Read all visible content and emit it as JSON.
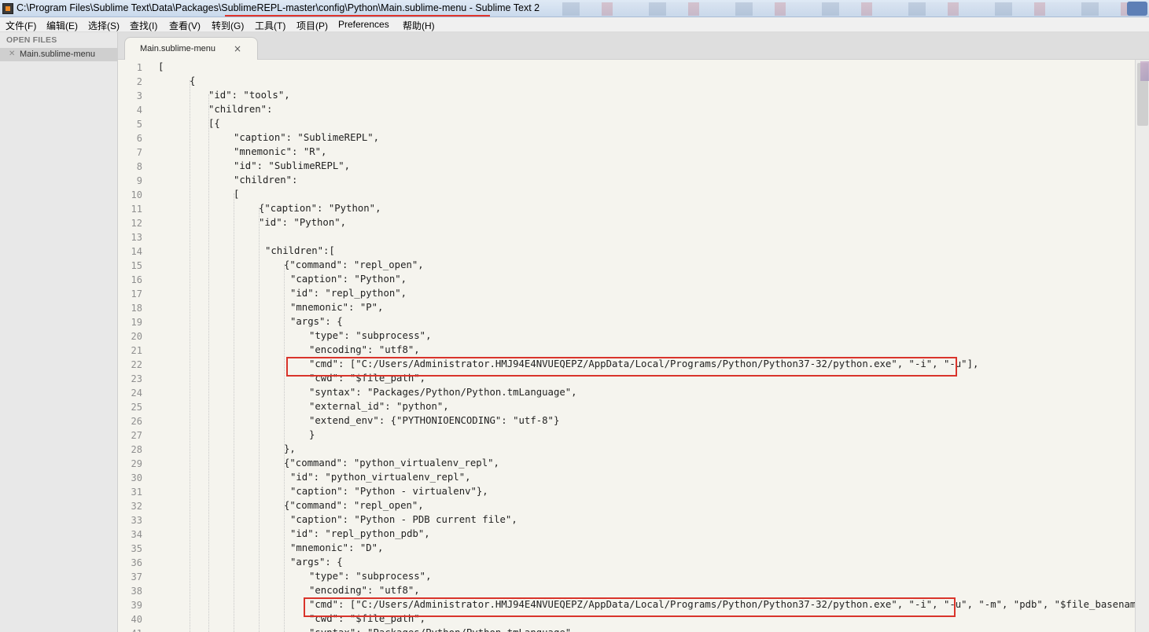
{
  "window": {
    "title": "C:\\Program Files\\Sublime Text\\Data\\Packages\\SublimeREPL-master\\config\\Python\\Main.sublime-menu - Sublime Text 2"
  },
  "menu": [
    "文件(F)",
    "编辑(E)",
    "选择(S)",
    "查找(I)",
    "查看(V)",
    "转到(G)",
    "工具(T)",
    "项目(P)",
    "Preferences",
    "帮助(H)"
  ],
  "sidebar": {
    "header": "OPEN FILES",
    "file": "Main.sublime-menu",
    "file_close": "✕"
  },
  "tab": {
    "label": "Main.sublime-menu",
    "close": "×"
  },
  "icons": {
    "app": "sublime-icon",
    "close": "close-icon"
  },
  "colors": {
    "highlight": "#d9342b",
    "editor_bg": "#f5f4ee"
  },
  "lines": [
    {
      "n": "1",
      "text": "["
    },
    {
      "n": "2",
      "text": "{"
    },
    {
      "n": "3",
      "text": "\"id\": \"tools\","
    },
    {
      "n": "4",
      "text": "\"children\":"
    },
    {
      "n": "5",
      "text": "[{"
    },
    {
      "n": "6",
      "text": "\"caption\": \"SublimeREPL\","
    },
    {
      "n": "7",
      "text": "\"mnemonic\": \"R\","
    },
    {
      "n": "8",
      "text": "\"id\": \"SublimeREPL\","
    },
    {
      "n": "9",
      "text": "\"children\":"
    },
    {
      "n": "10",
      "text": "["
    },
    {
      "n": "11",
      "text": "{\"caption\": \"Python\","
    },
    {
      "n": "12",
      "text": "\"id\": \"Python\","
    },
    {
      "n": "13",
      "text": ""
    },
    {
      "n": "14",
      "text": "\"children\":["
    },
    {
      "n": "15",
      "text": "{\"command\": \"repl_open\","
    },
    {
      "n": "16",
      "text": "\"caption\": \"Python\","
    },
    {
      "n": "17",
      "text": "\"id\": \"repl_python\","
    },
    {
      "n": "18",
      "text": "\"mnemonic\": \"P\","
    },
    {
      "n": "19",
      "text": "\"args\": {"
    },
    {
      "n": "20",
      "text": "\"type\": \"subprocess\","
    },
    {
      "n": "21",
      "text": "\"encoding\": \"utf8\","
    },
    {
      "n": "22",
      "text": "\"cmd\": [\"C:/Users/Administrator.HMJ94E4NVUEQEPZ/AppData/Local/Programs/Python/Python37-32/python.exe\", \"-i\", \"-u\"],"
    },
    {
      "n": "23",
      "text": "\"cwd\": \"$file_path\","
    },
    {
      "n": "24",
      "text": "\"syntax\": \"Packages/Python/Python.tmLanguage\","
    },
    {
      "n": "25",
      "text": "\"external_id\": \"python\","
    },
    {
      "n": "26",
      "text": "\"extend_env\": {\"PYTHONIOENCODING\": \"utf-8\"}"
    },
    {
      "n": "27",
      "text": "}"
    },
    {
      "n": "28",
      "text": "},"
    },
    {
      "n": "29",
      "text": "{\"command\": \"python_virtualenv_repl\","
    },
    {
      "n": "30",
      "text": "\"id\": \"python_virtualenv_repl\","
    },
    {
      "n": "31",
      "text": "\"caption\": \"Python - virtualenv\"},"
    },
    {
      "n": "32",
      "text": "{\"command\": \"repl_open\","
    },
    {
      "n": "33",
      "text": "\"caption\": \"Python - PDB current file\","
    },
    {
      "n": "34",
      "text": "\"id\": \"repl_python_pdb\","
    },
    {
      "n": "35",
      "text": "\"mnemonic\": \"D\","
    },
    {
      "n": "36",
      "text": "\"args\": {"
    },
    {
      "n": "37",
      "text": "\"type\": \"subprocess\","
    },
    {
      "n": "38",
      "text": "\"encoding\": \"utf8\","
    },
    {
      "n": "39",
      "text": "\"cmd\": [\"C:/Users/Administrator.HMJ94E4NVUEQEPZ/AppData/Local/Programs/Python/Python37-32/python.exe\", \"-i\", \"-u\", \"-m\", \"pdb\", \"$file_basename\"],"
    },
    {
      "n": "40",
      "text": "\"cwd\": \"$file_path\","
    },
    {
      "n": "41",
      "text": "\"syntax\": \"Packages/Python/Python.tmLanguage\","
    }
  ]
}
